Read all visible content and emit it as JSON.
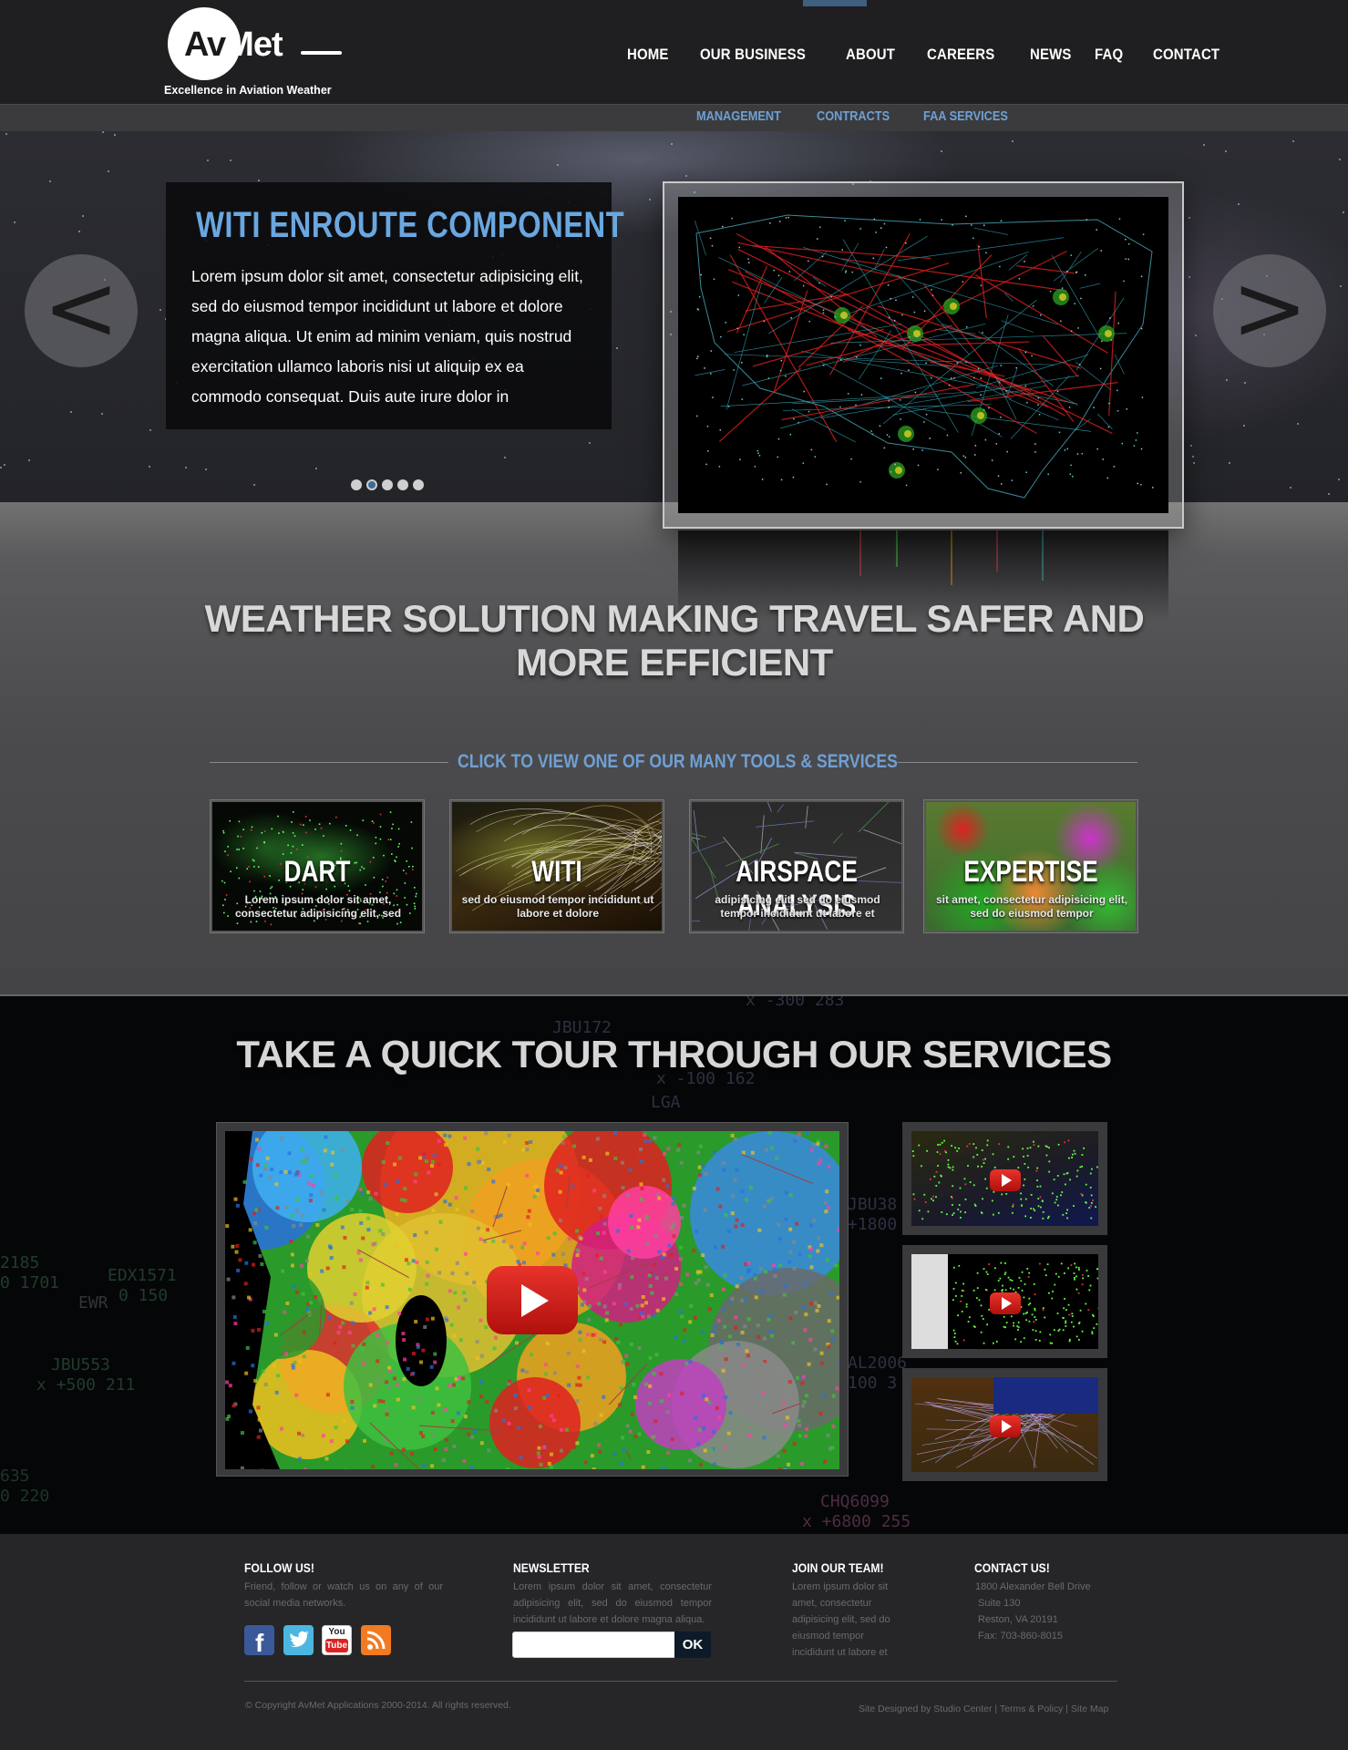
{
  "brand": {
    "logo_prefix": "Av",
    "logo_suffix": "Met",
    "tagline": "Excellence in Aviation Weather"
  },
  "nav": {
    "items": [
      "HOME",
      "OUR BUSINESS",
      "ABOUT",
      "CAREERS",
      "NEWS",
      "FAQ",
      "CONTACT"
    ],
    "sub_items": [
      "MANAGEMENT",
      "CONTRACTS",
      "FAA SERVICES"
    ]
  },
  "hero": {
    "title": "WITI ENROUTE COMPONENT",
    "body": "Lorem ipsum dolor sit amet, consectetur adipisicing elit, sed do eiusmod tempor incididunt ut labore et dolore magna aliqua. Ut enim ad minim veniam, quis nostrud exercitation ullamco laboris nisi ut aliquip ex ea commodo consequat. Duis aute irure dolor in",
    "prev_label": "<",
    "next_label": ">",
    "slide_count": 5,
    "active_slide": 2
  },
  "tagline": {
    "text": "WEATHER SOLUTION MAKING TRAVEL SAFER AND MORE EFFICIENT"
  },
  "tools": {
    "heading": "CLICK TO VIEW ONE OF OUR MANY TOOLS & SERVICES",
    "cards": [
      {
        "title": "DART",
        "desc": "Lorem ipsum dolor sit amet, consectetur adipisicing elit, sed"
      },
      {
        "title": "WITI",
        "desc": "sed do eiusmod tempor incididunt ut labore et dolore"
      },
      {
        "title": "AIRSPACE ANALYSIS",
        "desc": "adipisicing elit, sed do eiusmod tempor incididunt ut labore et"
      },
      {
        "title": "EXPERTISE",
        "desc": "sit amet, consectetur adipisicing elit, sed do eiusmod tempor"
      }
    ]
  },
  "tour": {
    "title": "TAKE A QUICK TOUR THROUGH OUR SERVICES"
  },
  "footer": {
    "follow": {
      "heading": "FOLLOW US!",
      "text": "Friend, follow or watch us on any of our social media networks.",
      "icons": [
        "facebook-icon",
        "twitter-icon",
        "youtube-icon",
        "rss-icon"
      ],
      "youtube_top": "You",
      "youtube_bottom": "Tube"
    },
    "newsletter": {
      "heading": "NEWSLETTER",
      "text": "Lorem ipsum dolor sit amet, consectetur adipisicing elit, sed do eiusmod tempor incididunt ut labore et dolore magna aliqua.",
      "input_value": "",
      "button": "OK"
    },
    "join": {
      "heading": "JOIN OUR TEAM!",
      "text": "Lorem ipsum dolor sit amet, consectetur adipisicing elit, sed do eiusmod tempor incididunt ut labore et"
    },
    "contact": {
      "heading": "CONTACT US!",
      "lines": [
        "1800 Alexander Bell Drive",
        "Suite 130",
        "Reston, VA 20191",
        "Fax: 703-860-8015"
      ]
    },
    "copyright": "© Copyright AvMet Applications 2000-2014. All rights reserved.",
    "links": [
      "Site Designed by Studio Center",
      "Terms & Policy",
      "Site Map"
    ]
  },
  "colors": {
    "accent_blue": "#6fa0d4",
    "header_bg": "#1f1f21",
    "youtube_red": "#e8332b"
  }
}
